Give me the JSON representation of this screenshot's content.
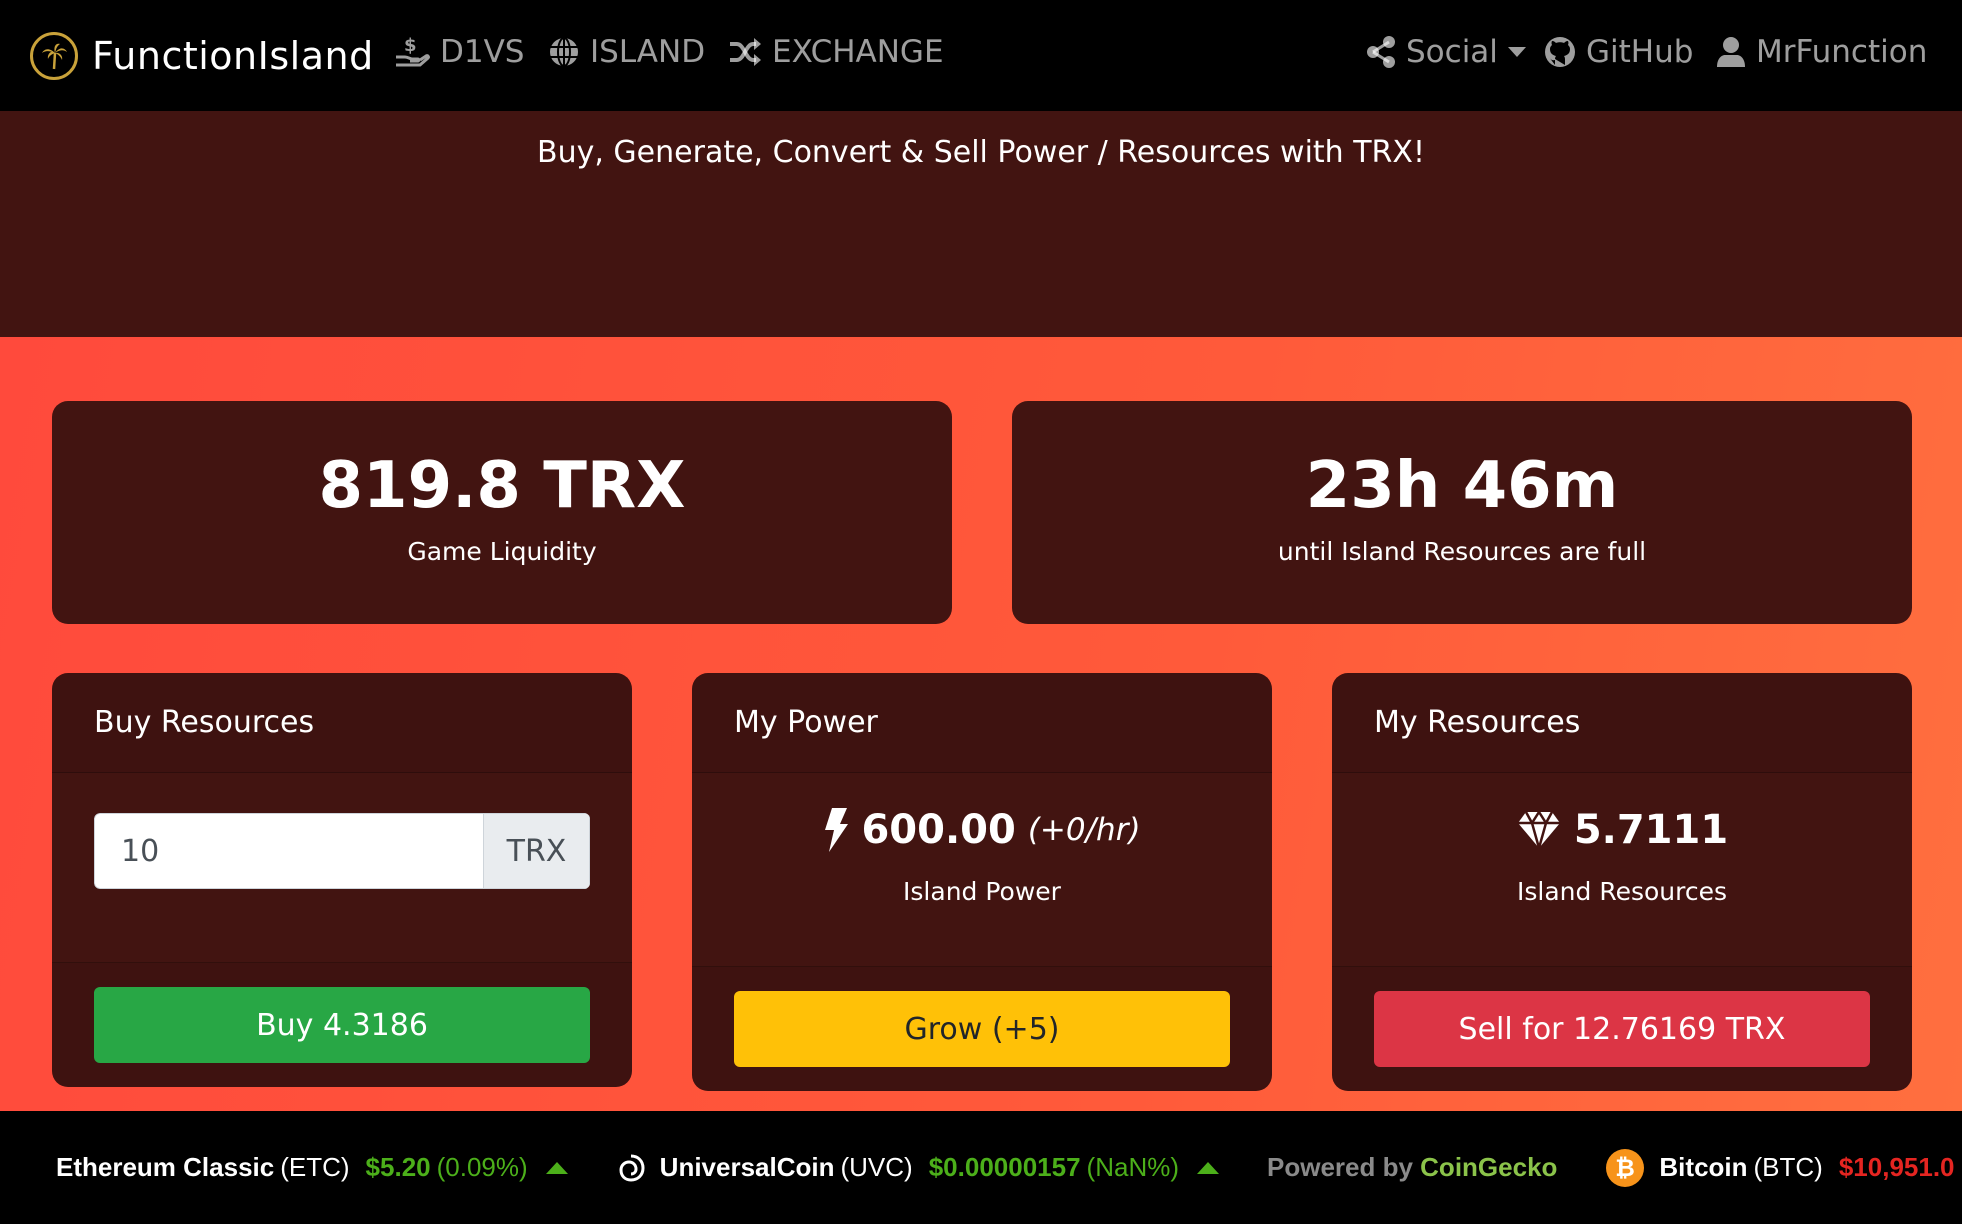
{
  "navbar": {
    "brand": "FunctionIsland",
    "links": [
      {
        "label": "D1VS",
        "icon": "hand-dollar-icon"
      },
      {
        "label": "ISLAND",
        "icon": "globe-icon"
      },
      {
        "label": "EXCHANGE",
        "icon": "shuffle-icon"
      }
    ],
    "right": [
      {
        "label": "Social",
        "icon": "share-icon"
      },
      {
        "label": "GitHub",
        "icon": "github-icon"
      },
      {
        "label": "MrFunction",
        "icon": "user-icon"
      }
    ]
  },
  "hero": {
    "tagline": "Buy, Generate, Convert & Sell Power / Resources with TRX!"
  },
  "stats": {
    "liquidity": {
      "value": "819.8 TRX",
      "label": "Game Liquidity"
    },
    "timer": {
      "value": "23h 46m",
      "label": "until Island Resources are full"
    }
  },
  "buy": {
    "title": "Buy Resources",
    "amount": "10",
    "unit": "TRX",
    "button": "Buy 4.3186"
  },
  "power": {
    "title": "My Power",
    "value": "600.00",
    "rate": "(+0/hr)",
    "label": "Island Power",
    "button": "Grow (+5)"
  },
  "resources": {
    "title": "My Resources",
    "value": "5.7111",
    "label": "Island Resources",
    "button": "Sell for 12.76169 TRX"
  },
  "ticker": {
    "items": [
      {
        "name": "Ethereum Classic",
        "symbol": "(ETC)",
        "price": "$5.20",
        "change": "(0.09%)"
      },
      {
        "name": "UniversalCoin",
        "symbol": "(UVC)",
        "price": "$0.00000157",
        "change": "(NaN%)"
      }
    ],
    "powered_prefix": "Powered by ",
    "powered_brand": "CoinGecko",
    "last": {
      "name": "Bitcoin",
      "symbol": "(BTC)",
      "price": "$10,951.0"
    }
  },
  "colors": {
    "navbar": "#000000",
    "hero": "#421411",
    "card": "#421411",
    "gradient_start": "#ff4a3c",
    "gradient_end": "#ff6f3f",
    "buy_button": "#28a745",
    "grow_button": "#ffc107",
    "sell_button": "#dc3545",
    "ticker_up": "#4caf1a",
    "ticker_down": "#e52521"
  }
}
